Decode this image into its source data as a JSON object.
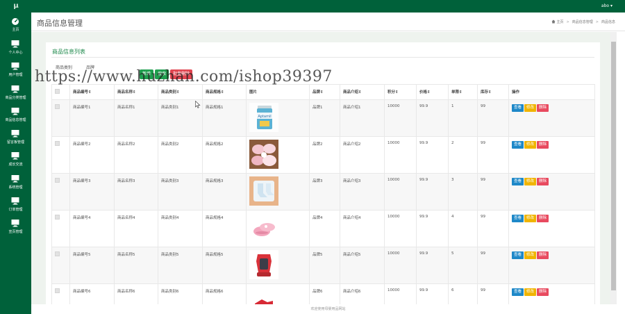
{
  "topbar": {
    "logo": "μ",
    "user": "abo ▾"
  },
  "sidebar": {
    "items": [
      {
        "label": "主页",
        "icon": "dashboard-icon"
      },
      {
        "label": "个人中心",
        "icon": "monitor-icon"
      },
      {
        "label": "用户管理",
        "icon": "monitor-icon"
      },
      {
        "label": "商品分类管理",
        "icon": "monitor-icon"
      },
      {
        "label": "商品信息管理",
        "icon": "monitor-icon"
      },
      {
        "label": "留言板管理",
        "icon": "monitor-icon"
      },
      {
        "label": "成长交流",
        "icon": "monitor-icon"
      },
      {
        "label": "系统管理",
        "icon": "monitor-icon"
      },
      {
        "label": "订单管理",
        "icon": "monitor-icon"
      },
      {
        "label": "宣页管理",
        "icon": "monitor-icon"
      }
    ]
  },
  "header": {
    "title": "商品信息管理",
    "breadcrumb": [
      "主页",
      "商品信息管理",
      "商品信息"
    ]
  },
  "panel": {
    "title": "商品信息列表",
    "filters": [
      "商品类别",
      "品牌"
    ],
    "buttons": [
      "新增",
      "搜索",
      "批量删除"
    ]
  },
  "table": {
    "headers": [
      "",
      "商品编号⇕",
      "商品名称⇕",
      "商品类别⇕",
      "商品规格⇕",
      "图片",
      "品牌⇕",
      "商品介绍⇕",
      "积分⇕",
      "价格⇕",
      "单限⇕",
      "库存⇕",
      "操作"
    ],
    "rows": [
      {
        "id": "商品编号1",
        "name": "商品名称1",
        "category": "商品类别1",
        "spec": "商品规格1",
        "brand": "品牌1",
        "intro": "商品介绍1",
        "points": "10000",
        "price": "99.9",
        "limit": "1",
        "stock": "99",
        "image": "milk-powder"
      },
      {
        "id": "商品编号2",
        "name": "商品名称2",
        "category": "商品类别2",
        "spec": "商品规格2",
        "brand": "品牌2",
        "intro": "商品介绍2",
        "points": "10000",
        "price": "99.9",
        "limit": "2",
        "stock": "99",
        "image": "baby-clothes"
      },
      {
        "id": "商品编号3",
        "name": "商品名称3",
        "category": "商品类别3",
        "spec": "商品规格3",
        "brand": "品牌3",
        "intro": "商品介绍3",
        "points": "10000",
        "price": "99.9",
        "limit": "3",
        "stock": "99",
        "image": "baby-socks"
      },
      {
        "id": "商品编号4",
        "name": "商品名称4",
        "category": "商品类别4",
        "spec": "商品规格4",
        "brand": "品牌4",
        "intro": "商品介绍4",
        "points": "10000",
        "price": "99.9",
        "limit": "4",
        "stock": "99",
        "image": "baby-shoes"
      },
      {
        "id": "商品编号5",
        "name": "商品名称5",
        "category": "商品类别5",
        "spec": "商品规格5",
        "brand": "品牌5",
        "intro": "商品介绍5",
        "points": "10000",
        "price": "99.9",
        "limit": "5",
        "stock": "99",
        "image": "car-seat"
      },
      {
        "id": "商品编号6",
        "name": "商品名称6",
        "category": "商品类别6",
        "spec": "商品规格6",
        "brand": "品牌6",
        "intro": "商品介绍6",
        "points": "10000",
        "price": "99.9",
        "limit": "6",
        "stock": "99",
        "image": "red-item"
      }
    ],
    "actions": {
      "view": "查看",
      "edit": "修改",
      "delete": "删除"
    }
  },
  "footer": "欢迎使用母婴用品网站",
  "watermark": "https://www.huzhan.com/ishop39397",
  "colors": {
    "brand": "#00613a",
    "accent": "#1f8a4c",
    "view": "#1e88c8",
    "edit": "#f0b400",
    "delete": "#e84a5f"
  }
}
